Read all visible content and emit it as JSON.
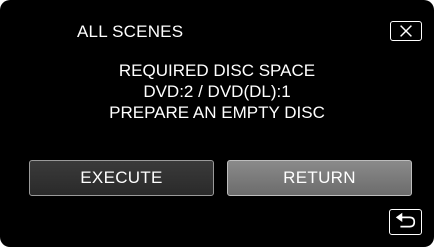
{
  "dialog": {
    "title": "ALL SCENES",
    "message_lines": [
      "REQUIRED DISC SPACE",
      "DVD:2 / DVD(DL):1",
      "PREPARE AN EMPTY DISC"
    ],
    "buttons": {
      "execute_label": "EXECUTE",
      "return_label": "RETURN"
    }
  },
  "icons": {
    "close": "close-icon",
    "back": "back-arrow-icon"
  },
  "colors": {
    "background": "#000000",
    "text": "#ffffff",
    "execute_button": "#2f2f2f",
    "return_button": "#7a7a7a"
  }
}
